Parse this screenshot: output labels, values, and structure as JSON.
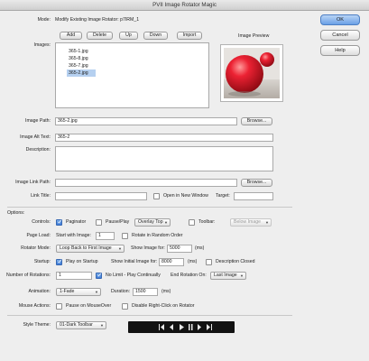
{
  "window": {
    "title": "PVII Image Rotator Magic"
  },
  "mode": {
    "label": "Mode:",
    "value": "Modify Existing Image Rotator: p7IRM_1"
  },
  "side_buttons": {
    "ok": "OK",
    "cancel": "Cancel",
    "help": "Help"
  },
  "images": {
    "label": "Images:",
    "toolbar": {
      "add": "Add",
      "delete": "Delete",
      "up": "Up",
      "down": "Down",
      "import": "Import"
    },
    "items": [
      "365-1.jpg",
      "365-8.jpg",
      "365-7.jpg",
      "365-2.jpg"
    ],
    "selected_index": 3
  },
  "preview": {
    "label": "Image Preview"
  },
  "image_path": {
    "label": "Image Path:",
    "value": "365-2.jpg",
    "browse": "Browse..."
  },
  "alt_text": {
    "label": "Image Alt Text:",
    "value": "365-2"
  },
  "description": {
    "label": "Description:",
    "value": ""
  },
  "link_path": {
    "label": "Image Link Path:",
    "value": "",
    "browse": "Browse..."
  },
  "link_title": {
    "label": "Link Title:",
    "value": "",
    "new_window": "Open in New Window",
    "target_label": "Target:",
    "target_value": ""
  },
  "options": {
    "heading": "Options:",
    "controls": {
      "label": "Controls:",
      "paginator": "Paginator",
      "pause_play": "Pause/Play",
      "overlay": "Overlay Top",
      "toolbar": "Toolbar:",
      "toolbar_position": "Below Image"
    },
    "page_load": {
      "label": "Page Load:",
      "start_with": "Start with Image:",
      "start_value": "1",
      "random": "Rotate in Random Order"
    },
    "rotator_mode": {
      "label": "Rotator Mode:",
      "value": "Loop Back to First Image",
      "show_for": "Show Image for:",
      "show_value": "5000",
      "unit": "(ms)"
    },
    "startup": {
      "label": "Startup:",
      "play_on_startup": "Play on Startup",
      "initial_for": "Show Initial Image for:",
      "initial_value": "8000",
      "unit": "(ms)",
      "desc_closed": "Description Closed"
    },
    "rotations": {
      "label": "Number of Rotations:",
      "value": "1",
      "no_limit": "No Limit - Play Continually",
      "end_on": "End Rotation On:",
      "end_value": "Last Image"
    },
    "animation": {
      "label": "Animation:",
      "value": "1-Fade",
      "duration": "Duration:",
      "duration_value": "1500",
      "unit": "(ms)"
    },
    "mouse": {
      "label": "Mouse Actions:",
      "pause": "Pause on MouseOver",
      "disable_right": "Disable Right-Click on Rotator"
    },
    "style": {
      "label": "Style Theme:",
      "value": "01-Dark Toolbar"
    }
  },
  "checkbox_states": {
    "paginator": true,
    "pause_play": false,
    "toolbar": false,
    "random": false,
    "play_on_startup": true,
    "desc_closed": false,
    "no_limit": true,
    "pause_mouseover": false,
    "disable_right": false,
    "new_window": false
  },
  "colors": {
    "list_selection": "#b5d0f0",
    "preview_red": "#e8182b",
    "toolbar_dark": "#121212"
  }
}
